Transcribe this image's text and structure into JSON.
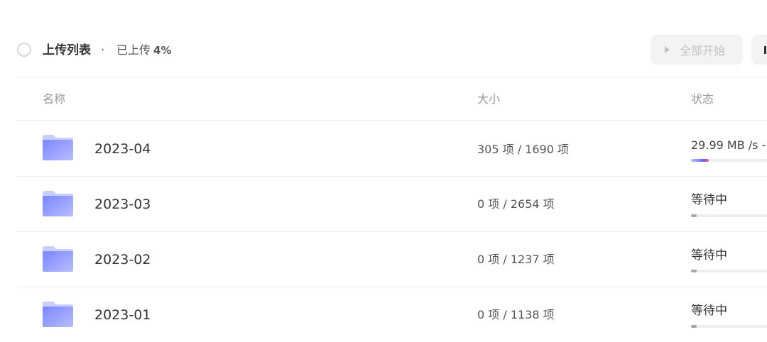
{
  "header": {
    "title": "上传列表",
    "separator": "·",
    "uploaded_label": "已上传",
    "uploaded_percent": "4%",
    "start_all_label": "全部开始"
  },
  "columns": {
    "name": "名称",
    "size": "大小",
    "status": "状态"
  },
  "rows": [
    {
      "name": "2023-04",
      "size": "305 项 / 1690 项",
      "status": "29.99 MB /s -",
      "progress": 0.18,
      "state": "uploading"
    },
    {
      "name": "2023-03",
      "size": "0 项 / 2654 项",
      "status": "等待中",
      "progress": 0.06,
      "state": "waiting"
    },
    {
      "name": "2023-02",
      "size": "0 项 / 1237 项",
      "status": "等待中",
      "progress": 0.06,
      "state": "waiting"
    },
    {
      "name": "2023-01",
      "size": "0 项 / 1138 项",
      "status": "等待中",
      "progress": 0.06,
      "state": "waiting"
    }
  ],
  "icons": {
    "select_all": "circle-checkbox-icon",
    "start_all": "play-icon",
    "pause_all": "pause-icon",
    "folder": "folder-icon"
  },
  "colors": {
    "folder_light": "#c8cfff",
    "folder_main": "#7d8cff",
    "progress_active_start": "#b9c2ff",
    "progress_active_end": "#ff5a85",
    "progress_idle": "#a6a6a6"
  }
}
